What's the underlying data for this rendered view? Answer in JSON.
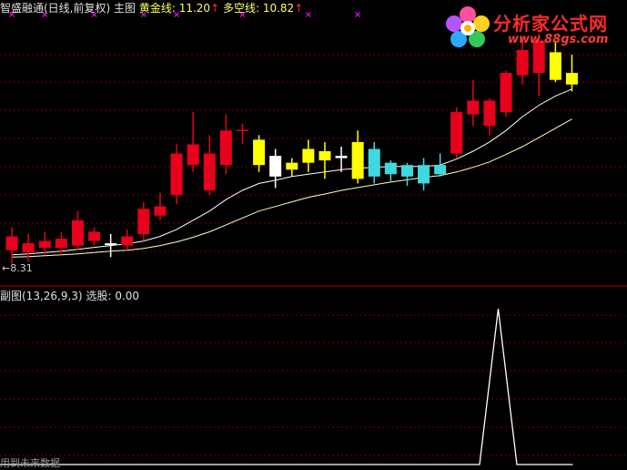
{
  "header": {
    "indicator": "智盛融通(日线,前复权) 主图",
    "gold_label": "黄金线:",
    "gold_value": "11.20",
    "gold_arrow": "↑",
    "bull_bear_label": "多空线:",
    "bull_bear_value": "10.82",
    "bull_bear_arrow": "↑"
  },
  "sub_header": {
    "title": "副图(13,26,9,3)",
    "select_label": "选股:",
    "select_value": "0.00"
  },
  "footer_note": "用到未来数据",
  "low_label": "←8.31",
  "logo": {
    "name": "分析家公式网",
    "url": "www.88gs.com"
  },
  "colors": {
    "background": "#000000",
    "up_candle": "#e8001c",
    "down_candle": "#40d8e0",
    "yellow_candle": "#ffff00",
    "white_candle": "#ffffff",
    "grid": "#7a0000",
    "header_gold": "#ffff66",
    "header_arrow": "#ff3030",
    "magenta_marker": "#ff00ff",
    "ma_white": "#ffffff",
    "ma_yellow": "#ffffc0"
  },
  "chart_data": [
    {
      "type": "candlestick",
      "panel": "main",
      "ylim": [
        8.0,
        13.6
      ],
      "grid": "dashed horizontal",
      "candles": [
        {
          "o": 8.9,
          "c": 8.6,
          "h": 9.1,
          "l": 8.3,
          "s": "red"
        },
        {
          "o": 8.75,
          "c": 8.55,
          "h": 8.95,
          "l": 8.35,
          "s": "red"
        },
        {
          "o": 8.8,
          "c": 8.65,
          "h": 9.0,
          "l": 8.5,
          "s": "red"
        },
        {
          "o": 8.65,
          "c": 8.85,
          "h": 9.0,
          "l": 8.5,
          "s": "red"
        },
        {
          "o": 8.7,
          "c": 9.25,
          "h": 9.45,
          "l": 8.6,
          "s": "red"
        },
        {
          "o": 8.8,
          "c": 9.0,
          "h": 9.1,
          "l": 8.7,
          "s": "red"
        },
        {
          "o": 8.75,
          "c": 8.75,
          "h": 8.95,
          "l": 8.45,
          "s": "white"
        },
        {
          "o": 8.7,
          "c": 8.9,
          "h": 9.05,
          "l": 8.6,
          "s": "red"
        },
        {
          "o": 8.95,
          "c": 9.5,
          "h": 9.65,
          "l": 8.8,
          "s": "red"
        },
        {
          "o": 9.35,
          "c": 9.55,
          "h": 9.85,
          "l": 9.25,
          "s": "red"
        },
        {
          "o": 9.8,
          "c": 10.7,
          "h": 10.9,
          "l": 9.6,
          "s": "red"
        },
        {
          "o": 10.45,
          "c": 10.9,
          "h": 11.6,
          "l": 10.3,
          "s": "red"
        },
        {
          "o": 9.9,
          "c": 10.7,
          "h": 11.1,
          "l": 9.8,
          "s": "red"
        },
        {
          "o": 10.45,
          "c": 11.2,
          "h": 11.55,
          "l": 10.25,
          "s": "red"
        },
        {
          "o": 11.2,
          "c": 11.2,
          "h": 11.35,
          "l": 10.9,
          "s": "red_doji"
        },
        {
          "o": 11.0,
          "c": 10.45,
          "h": 11.1,
          "l": 10.3,
          "s": "yellow"
        },
        {
          "o": 10.65,
          "c": 10.2,
          "h": 10.8,
          "l": 9.95,
          "s": "white"
        },
        {
          "o": 10.5,
          "c": 10.35,
          "h": 10.6,
          "l": 10.2,
          "s": "yellow"
        },
        {
          "o": 10.8,
          "c": 10.5,
          "h": 11.0,
          "l": 10.3,
          "s": "yellow"
        },
        {
          "o": 10.75,
          "c": 10.55,
          "h": 10.95,
          "l": 10.15,
          "s": "yellow"
        },
        {
          "o": 10.65,
          "c": 10.6,
          "h": 10.85,
          "l": 10.3,
          "s": "white"
        },
        {
          "o": 10.95,
          "c": 10.15,
          "h": 11.2,
          "l": 10.05,
          "s": "yellow"
        },
        {
          "o": 10.8,
          "c": 10.2,
          "h": 10.95,
          "l": 10.05,
          "s": "cyan"
        },
        {
          "o": 10.5,
          "c": 10.25,
          "h": 10.55,
          "l": 10.1,
          "s": "cyan"
        },
        {
          "o": 10.45,
          "c": 10.2,
          "h": 10.5,
          "l": 10.0,
          "s": "cyan"
        },
        {
          "o": 10.45,
          "c": 10.05,
          "h": 10.6,
          "l": 9.9,
          "s": "cyan"
        },
        {
          "o": 10.45,
          "c": 10.25,
          "h": 10.7,
          "l": 10.2,
          "s": "cyan"
        },
        {
          "o": 10.7,
          "c": 11.6,
          "h": 11.7,
          "l": 10.6,
          "s": "red"
        },
        {
          "o": 11.55,
          "c": 11.85,
          "h": 12.3,
          "l": 11.3,
          "s": "red"
        },
        {
          "o": 11.3,
          "c": 11.85,
          "h": 11.9,
          "l": 11.1,
          "s": "red"
        },
        {
          "o": 11.6,
          "c": 12.45,
          "h": 12.5,
          "l": 11.5,
          "s": "red"
        },
        {
          "o": 12.4,
          "c": 12.95,
          "h": 13.25,
          "l": 12.2,
          "s": "red"
        },
        {
          "o": 12.45,
          "c": 13.15,
          "h": 13.3,
          "l": 11.95,
          "s": "red"
        },
        {
          "o": 12.9,
          "c": 12.3,
          "h": 13.15,
          "l": 12.25,
          "s": "yellow"
        },
        {
          "o": 12.45,
          "c": 12.2,
          "h": 12.85,
          "l": 12.05,
          "s": "yellow"
        }
      ],
      "ma_white": [
        8.5,
        8.52,
        8.55,
        8.58,
        8.62,
        8.66,
        8.7,
        8.74,
        8.8,
        8.9,
        9.05,
        9.25,
        9.45,
        9.7,
        9.9,
        10.05,
        10.12,
        10.2,
        10.25,
        10.3,
        10.35,
        10.38,
        10.4,
        10.42,
        10.42,
        10.42,
        10.45,
        10.58,
        10.75,
        10.95,
        11.2,
        11.5,
        11.75,
        11.95,
        12.1
      ],
      "ma_yellow": [
        8.45,
        8.46,
        8.48,
        8.5,
        8.52,
        8.55,
        8.58,
        8.6,
        8.64,
        8.7,
        8.78,
        8.88,
        9.0,
        9.15,
        9.3,
        9.45,
        9.55,
        9.65,
        9.75,
        9.82,
        9.9,
        9.96,
        10.02,
        10.08,
        10.13,
        10.18,
        10.22,
        10.3,
        10.4,
        10.52,
        10.68,
        10.85,
        11.05,
        11.25,
        11.45
      ],
      "markers_top": [
        0,
        2,
        5,
        8,
        10,
        14,
        18,
        21
      ]
    },
    {
      "type": "line",
      "panel": "sub",
      "title": "副图(13,26,9,3)",
      "ylim": [
        0,
        1.0
      ],
      "grid": "dashed horizontal",
      "x": [
        0,
        29,
        30,
        31,
        34
      ],
      "values": [
        0,
        0,
        0.95,
        0,
        0
      ]
    }
  ]
}
